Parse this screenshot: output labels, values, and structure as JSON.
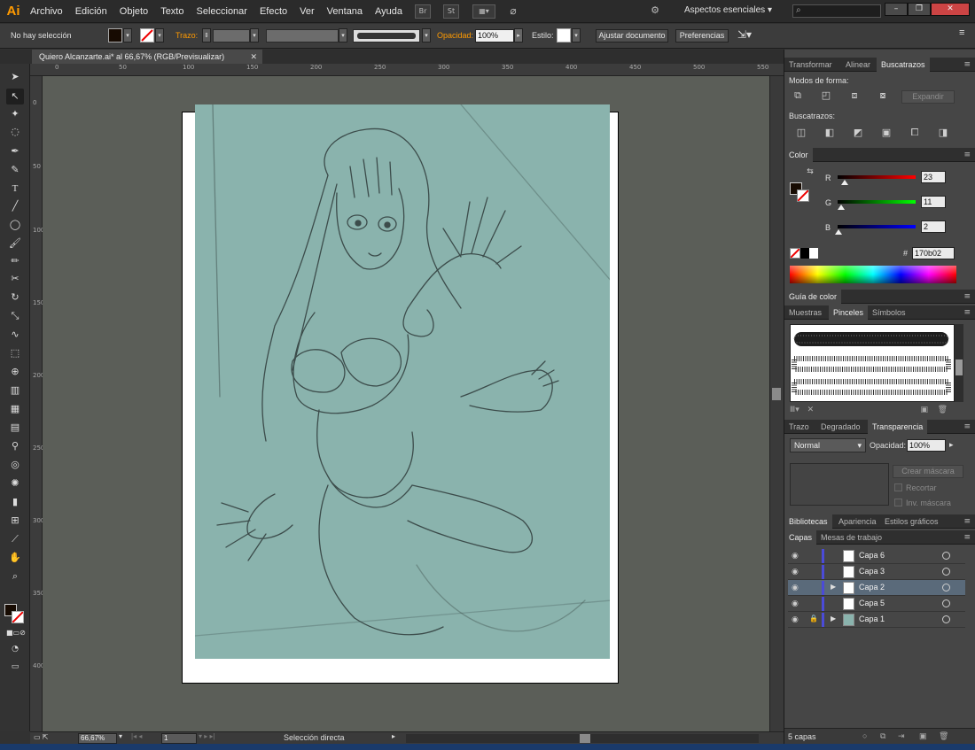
{
  "app": {
    "logo": "Ai",
    "workspace": "Aspectos esenciales"
  },
  "menu": [
    "Archivo",
    "Edición",
    "Objeto",
    "Texto",
    "Seleccionar",
    "Efecto",
    "Ver",
    "Ventana",
    "Ayuda"
  ],
  "menu_toolbar": {
    "br_label": "Br",
    "st_label": "St"
  },
  "control_bar": {
    "selection": "No hay selección",
    "stroke_label": "Trazo:",
    "opacity_label": "Opacidad:",
    "opacity_value": "100%",
    "style_label": "Estilo:",
    "doc_setup_button": "Ajustar documento",
    "preferences_button": "Preferencias"
  },
  "document": {
    "tab_title": "Quiero Alcanzarte.ai* al 66,67% (RGB/Previsualizar)"
  },
  "rulers": {
    "top": [
      "0",
      "50",
      "100",
      "150",
      "200",
      "250",
      "300",
      "350",
      "400",
      "450",
      "500",
      "550"
    ],
    "left": [
      "0",
      "50",
      "100",
      "150",
      "200",
      "250",
      "300",
      "350",
      "400"
    ]
  },
  "status_bar": {
    "zoom": "66,67%",
    "artboard": "1",
    "tool": "Selección directa"
  },
  "panels": {
    "pathfinder": {
      "tabs": [
        "Transformar",
        "Alinear",
        "Buscatrazos"
      ],
      "active_tab": "Buscatrazos",
      "shape_modes_label": "Modos de forma:",
      "expand_button": "Expandir",
      "pathfinders_label": "Buscatrazos:"
    },
    "color": {
      "title": "Color",
      "channels": [
        {
          "label": "R",
          "value": "23",
          "fraction": 0.09,
          "gradient": "#ff0000"
        },
        {
          "label": "G",
          "value": "11",
          "fraction": 0.04,
          "gradient": "#00ff00"
        },
        {
          "label": "B",
          "value": "2",
          "fraction": 0.01,
          "gradient": "#0000ff"
        }
      ],
      "hex_symbol": "#",
      "hex": "170b02"
    },
    "color_guide": {
      "title": "Guía de color"
    },
    "swatches": {
      "tabs": [
        "Muestras",
        "Pinceles",
        "Símbolos"
      ],
      "active_tab": "Pinceles"
    },
    "transparency": {
      "tabs": [
        "Trazo",
        "Degradado",
        "Transparencia"
      ],
      "active_tab": "Transparencia",
      "blend_mode": "Normal",
      "opacity_label": "Opacidad:",
      "opacity_value": "100%",
      "make_mask_button": "Crear máscara",
      "clip_label": "Recortar",
      "invert_label": "Inv. máscara"
    },
    "libraries": {
      "tabs": [
        "Bibliotecas",
        "Apariencia",
        "Estilos gráficos"
      ]
    },
    "layers": {
      "tabs": [
        "Capas",
        "Mesas de trabajo"
      ],
      "active_tab": "Capas",
      "items": [
        {
          "name": "Capa 6",
          "color": "#4b4bd8"
        },
        {
          "name": "Capa 3",
          "color": "#4b4bd8"
        },
        {
          "name": "Capa 2",
          "color": "#4b4bd8"
        },
        {
          "name": "Capa 5",
          "color": "#4b4bd8"
        },
        {
          "name": "Capa 1",
          "color": "#4b4bd8"
        }
      ],
      "count_label": "5 capas"
    }
  },
  "colors": {
    "accent": "#ff9a00",
    "canvas": "#5b5e58",
    "sketch_bg": "#8ab3ad"
  }
}
